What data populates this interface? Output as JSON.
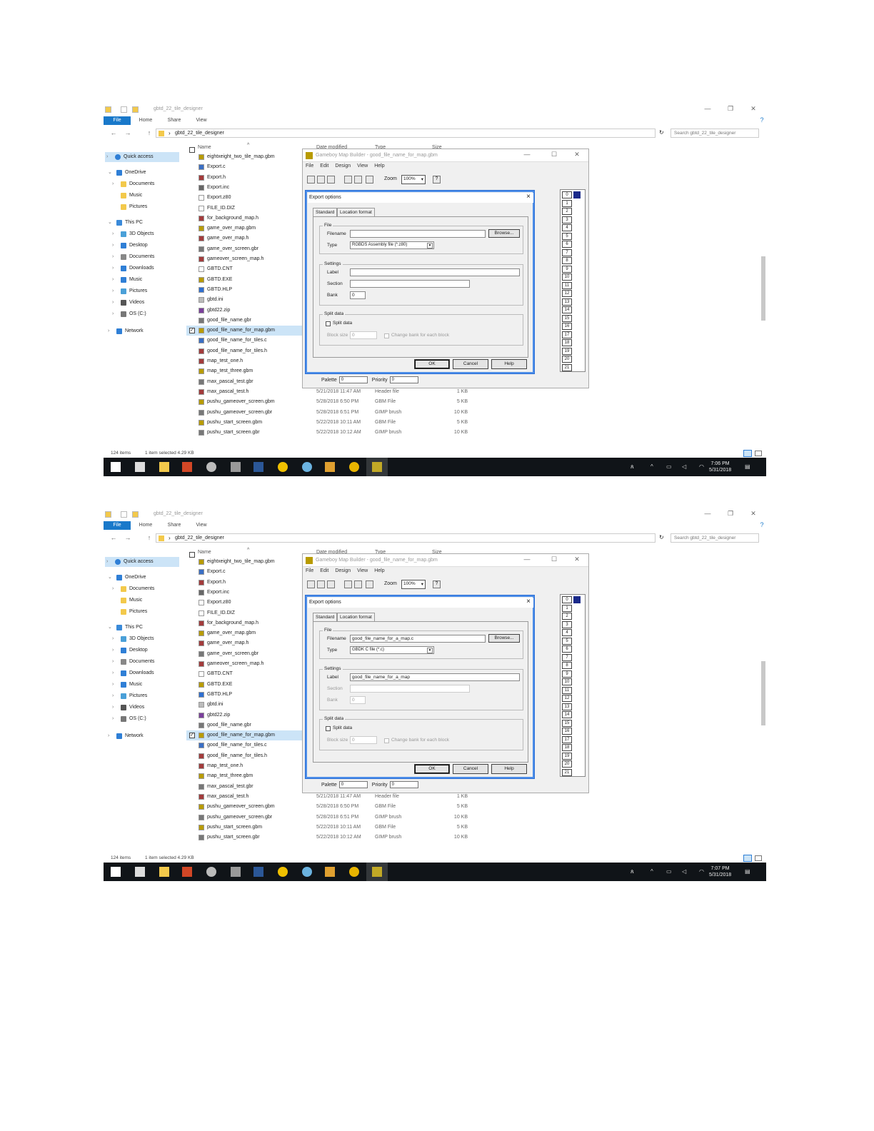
{
  "screens": [
    {
      "window_title": "gbtd_22_tile_designer",
      "ribbon_tabs": [
        "File",
        "Home",
        "Share",
        "View"
      ],
      "address_path": "gbtd_22_tile_designer",
      "search_placeholder": "Search gbtd_22_tile_designer",
      "nav_items": [
        {
          "label": "Quick access",
          "icon": "star-icon",
          "level": 0,
          "chev": "›",
          "selected": true
        },
        {
          "label": "OneDrive",
          "icon": "cloud-icon",
          "level": 0,
          "chev": "⌄"
        },
        {
          "label": "Documents",
          "icon": "folder-icon",
          "level": 1,
          "chev": "›"
        },
        {
          "label": "Music",
          "icon": "folder-icon",
          "level": 1,
          "chev": ""
        },
        {
          "label": "Pictures",
          "icon": "folder-icon",
          "level": 1,
          "chev": ""
        },
        {
          "label": "This PC",
          "icon": "computer-icon",
          "level": 0,
          "chev": "⌄"
        },
        {
          "label": "3D Objects",
          "icon": "cube-icon",
          "level": 1,
          "chev": "›"
        },
        {
          "label": "Desktop",
          "icon": "desktop-icon",
          "level": 1,
          "chev": "›"
        },
        {
          "label": "Documents",
          "icon": "documents-icon",
          "level": 1,
          "chev": "›"
        },
        {
          "label": "Downloads",
          "icon": "download-icon",
          "level": 1,
          "chev": "›"
        },
        {
          "label": "Music",
          "icon": "music-icon",
          "level": 1,
          "chev": "›"
        },
        {
          "label": "Pictures",
          "icon": "pictures-icon",
          "level": 1,
          "chev": "›"
        },
        {
          "label": "Videos",
          "icon": "videos-icon",
          "level": 1,
          "chev": "›"
        },
        {
          "label": "OS (C:)",
          "icon": "drive-icon",
          "level": 1,
          "chev": "›"
        },
        {
          "label": "Network",
          "icon": "network-icon",
          "level": 0,
          "chev": "›"
        }
      ],
      "column_headers": {
        "name": "Name",
        "date": "Date modified",
        "type": "Type",
        "size": "Size"
      },
      "files": [
        {
          "name": "eightxeight_two_tile_map.gbm",
          "icon": "gbm-icon"
        },
        {
          "name": "Export.c",
          "icon": "c-file-icon"
        },
        {
          "name": "Export.h",
          "icon": "h-file-icon"
        },
        {
          "name": "Export.inc",
          "icon": "inc-file-icon"
        },
        {
          "name": "Export.z80",
          "icon": "blank-file-icon"
        },
        {
          "name": "FILE_ID.DIZ",
          "icon": "blank-file-icon"
        },
        {
          "name": "for_background_map.h",
          "icon": "h-file-icon"
        },
        {
          "name": "game_over_map.gbm",
          "icon": "gbm-icon"
        },
        {
          "name": "game_over_map.h",
          "icon": "h-file-icon"
        },
        {
          "name": "game_over_screen.gbr",
          "icon": "gimp-icon"
        },
        {
          "name": "gameover_screen_map.h",
          "icon": "h-file-icon"
        },
        {
          "name": "GBTD.CNT",
          "icon": "blank-file-icon"
        },
        {
          "name": "GBTD.EXE",
          "icon": "gbm-icon"
        },
        {
          "name": "GBTD.HLP",
          "icon": "help-icon"
        },
        {
          "name": "gbtd.ini",
          "icon": "ini-icon"
        },
        {
          "name": "gbtd22.zip",
          "icon": "zip-icon"
        },
        {
          "name": "good_file_name.gbr",
          "icon": "gimp-icon"
        },
        {
          "name": "good_file_name_for_map.gbm",
          "icon": "gbm-icon",
          "selected": true
        },
        {
          "name": "good_file_name_for_tiles.c",
          "icon": "c-file-icon"
        },
        {
          "name": "good_file_name_for_tiles.h",
          "icon": "h-file-icon"
        },
        {
          "name": "map_test_one.h",
          "icon": "h-file-icon"
        },
        {
          "name": "map_test_three.gbm",
          "icon": "gbm-icon"
        },
        {
          "name": "max_pascal_test.gbr",
          "icon": "gimp-icon",
          "date": "5/21/2018 11:47 AM",
          "type": "GIMP brush",
          "size": "2 KB"
        },
        {
          "name": "max_pascal_test.h",
          "icon": "h-file-icon",
          "date": "5/21/2018 11:47 AM",
          "type": "Header file",
          "size": "1 KB"
        },
        {
          "name": "pushu_gameover_screen.gbm",
          "icon": "gbm-icon",
          "date": "5/28/2018 6:50 PM",
          "type": "GBM File",
          "size": "5 KB"
        },
        {
          "name": "pushu_gameover_screen.gbr",
          "icon": "gimp-icon",
          "date": "5/28/2018 6:51 PM",
          "type": "GIMP brush",
          "size": "10 KB"
        },
        {
          "name": "pushu_start_screen.gbm",
          "icon": "gbm-icon",
          "date": "5/22/2018 10:11 AM",
          "type": "GBM File",
          "size": "5 KB"
        },
        {
          "name": "pushu_start_screen.gbr",
          "icon": "gimp-icon",
          "date": "5/22/2018 10:12 AM",
          "type": "GIMP brush",
          "size": "10 KB"
        }
      ],
      "status_count": "124 items",
      "status_selected": "1 item selected  4.29 KB",
      "clock_time": "7:06 PM",
      "clock_date": "5/31/2018",
      "gbm_title": "Gameboy Map Builder - good_file_name_for_map.gbm",
      "gbm_menu": [
        "File",
        "Edit",
        "Design",
        "View",
        "Help"
      ],
      "zoom_label": "Zoom",
      "zoom_value": "100%",
      "row_numbers": [
        "0",
        "1",
        "2",
        "3",
        "4",
        "5",
        "6",
        "7",
        "8",
        "9",
        "10",
        "11",
        "12",
        "13",
        "14",
        "15",
        "16",
        "17",
        "18",
        "19",
        "20",
        "21"
      ],
      "palette_label": "Palette",
      "palette_value": "0",
      "priority_label": "Priority",
      "priority_value": "0",
      "dialog": {
        "title": "Export options",
        "tabs": [
          "Standard",
          "Location format"
        ],
        "file_group": "File",
        "filename_label": "Filename",
        "filename_value": "",
        "browse": "Browse...",
        "type_label": "Type",
        "type_value": "RGBDS Assembly file (*.z80)",
        "settings_group": "Settings",
        "label_label": "Label",
        "label_value": "",
        "section_label": "Section",
        "section_value": "",
        "bank_label": "Bank",
        "bank_value": "0",
        "split_group": "Split data",
        "split_check": "Split data",
        "block_size_label": "Block size",
        "block_size_value": "0",
        "change_bank": "Change bank for each block",
        "ok": "OK",
        "cancel": "Cancel",
        "help": "Help",
        "section_enabled": true
      }
    },
    {
      "window_title": "gbtd_22_tile_designer",
      "ribbon_tabs": [
        "File",
        "Home",
        "Share",
        "View"
      ],
      "address_path": "gbtd_22_tile_designer",
      "search_placeholder": "Search gbtd_22_tile_designer",
      "nav_items": [
        {
          "label": "Quick access",
          "icon": "star-icon",
          "level": 0,
          "chev": "›",
          "selected": true
        },
        {
          "label": "OneDrive",
          "icon": "cloud-icon",
          "level": 0,
          "chev": "⌄"
        },
        {
          "label": "Documents",
          "icon": "folder-icon",
          "level": 1,
          "chev": "›"
        },
        {
          "label": "Music",
          "icon": "folder-icon",
          "level": 1,
          "chev": ""
        },
        {
          "label": "Pictures",
          "icon": "folder-icon",
          "level": 1,
          "chev": ""
        },
        {
          "label": "This PC",
          "icon": "computer-icon",
          "level": 0,
          "chev": "⌄"
        },
        {
          "label": "3D Objects",
          "icon": "cube-icon",
          "level": 1,
          "chev": "›"
        },
        {
          "label": "Desktop",
          "icon": "desktop-icon",
          "level": 1,
          "chev": "›"
        },
        {
          "label": "Documents",
          "icon": "documents-icon",
          "level": 1,
          "chev": "›"
        },
        {
          "label": "Downloads",
          "icon": "download-icon",
          "level": 1,
          "chev": "›"
        },
        {
          "label": "Music",
          "icon": "music-icon",
          "level": 1,
          "chev": "›"
        },
        {
          "label": "Pictures",
          "icon": "pictures-icon",
          "level": 1,
          "chev": "›"
        },
        {
          "label": "Videos",
          "icon": "videos-icon",
          "level": 1,
          "chev": "›"
        },
        {
          "label": "OS (C:)",
          "icon": "drive-icon",
          "level": 1,
          "chev": "›"
        },
        {
          "label": "Network",
          "icon": "network-icon",
          "level": 0,
          "chev": "›"
        }
      ],
      "column_headers": {
        "name": "Name",
        "date": "Date modified",
        "type": "Type",
        "size": "Size"
      },
      "files": [
        {
          "name": "eightxeight_two_tile_map.gbm",
          "icon": "gbm-icon"
        },
        {
          "name": "Export.c",
          "icon": "c-file-icon"
        },
        {
          "name": "Export.h",
          "icon": "h-file-icon"
        },
        {
          "name": "Export.inc",
          "icon": "inc-file-icon"
        },
        {
          "name": "Export.z80",
          "icon": "blank-file-icon"
        },
        {
          "name": "FILE_ID.DIZ",
          "icon": "blank-file-icon"
        },
        {
          "name": "for_background_map.h",
          "icon": "h-file-icon"
        },
        {
          "name": "game_over_map.gbm",
          "icon": "gbm-icon"
        },
        {
          "name": "game_over_map.h",
          "icon": "h-file-icon"
        },
        {
          "name": "game_over_screen.gbr",
          "icon": "gimp-icon"
        },
        {
          "name": "gameover_screen_map.h",
          "icon": "h-file-icon"
        },
        {
          "name": "GBTD.CNT",
          "icon": "blank-file-icon"
        },
        {
          "name": "GBTD.EXE",
          "icon": "gbm-icon"
        },
        {
          "name": "GBTD.HLP",
          "icon": "help-icon"
        },
        {
          "name": "gbtd.ini",
          "icon": "ini-icon"
        },
        {
          "name": "gbtd22.zip",
          "icon": "zip-icon"
        },
        {
          "name": "good_file_name.gbr",
          "icon": "gimp-icon"
        },
        {
          "name": "good_file_name_for_map.gbm",
          "icon": "gbm-icon",
          "selected": true
        },
        {
          "name": "good_file_name_for_tiles.c",
          "icon": "c-file-icon"
        },
        {
          "name": "good_file_name_for_tiles.h",
          "icon": "h-file-icon"
        },
        {
          "name": "map_test_one.h",
          "icon": "h-file-icon"
        },
        {
          "name": "map_test_three.gbm",
          "icon": "gbm-icon"
        },
        {
          "name": "max_pascal_test.gbr",
          "icon": "gimp-icon",
          "date": "5/21/2018 11:47 AM",
          "type": "GIMP brush",
          "size": "2 KB"
        },
        {
          "name": "max_pascal_test.h",
          "icon": "h-file-icon",
          "date": "5/21/2018 11:47 AM",
          "type": "Header file",
          "size": "1 KB"
        },
        {
          "name": "pushu_gameover_screen.gbm",
          "icon": "gbm-icon",
          "date": "5/28/2018 6:50 PM",
          "type": "GBM File",
          "size": "5 KB"
        },
        {
          "name": "pushu_gameover_screen.gbr",
          "icon": "gimp-icon",
          "date": "5/28/2018 6:51 PM",
          "type": "GIMP brush",
          "size": "10 KB"
        },
        {
          "name": "pushu_start_screen.gbm",
          "icon": "gbm-icon",
          "date": "5/22/2018 10:11 AM",
          "type": "GBM File",
          "size": "5 KB"
        },
        {
          "name": "pushu_start_screen.gbr",
          "icon": "gimp-icon",
          "date": "5/22/2018 10:12 AM",
          "type": "GIMP brush",
          "size": "10 KB"
        }
      ],
      "status_count": "124 items",
      "status_selected": "1 item selected  4.29 KB",
      "clock_time": "7:07 PM",
      "clock_date": "5/31/2018",
      "gbm_title": "Gameboy Map Builder - good_file_name_for_map.gbm",
      "gbm_menu": [
        "File",
        "Edit",
        "Design",
        "View",
        "Help"
      ],
      "zoom_label": "Zoom",
      "zoom_value": "100%",
      "row_numbers": [
        "0",
        "1",
        "2",
        "3",
        "4",
        "5",
        "6",
        "7",
        "8",
        "9",
        "10",
        "11",
        "12",
        "13",
        "14",
        "15",
        "16",
        "17",
        "18",
        "19",
        "20",
        "21"
      ],
      "palette_label": "Palette",
      "palette_value": "0",
      "priority_label": "Priority",
      "priority_value": "0",
      "dialog": {
        "title": "Export options",
        "tabs": [
          "Standard",
          "Location format"
        ],
        "file_group": "File",
        "filename_label": "Filename",
        "filename_value": "good_file_name_for_a_map.c",
        "browse": "Browse...",
        "type_label": "Type",
        "type_value": "GBDK C file (*.c)",
        "settings_group": "Settings",
        "label_label": "Label",
        "label_value": "good_file_name_for_a_map",
        "section_label": "Section",
        "section_value": "",
        "bank_label": "Bank",
        "bank_value": "0",
        "split_group": "Split data",
        "split_check": "Split data",
        "block_size_label": "Block size",
        "block_size_value": "0",
        "change_bank": "Change bank for each block",
        "ok": "OK",
        "cancel": "Cancel",
        "help": "Help",
        "section_enabled": false
      }
    }
  ],
  "colors": {
    "accent": "#1979ca",
    "selection": "#cce4f7",
    "taskbar": "#101418",
    "dialog_border": "#2b6fd6"
  }
}
